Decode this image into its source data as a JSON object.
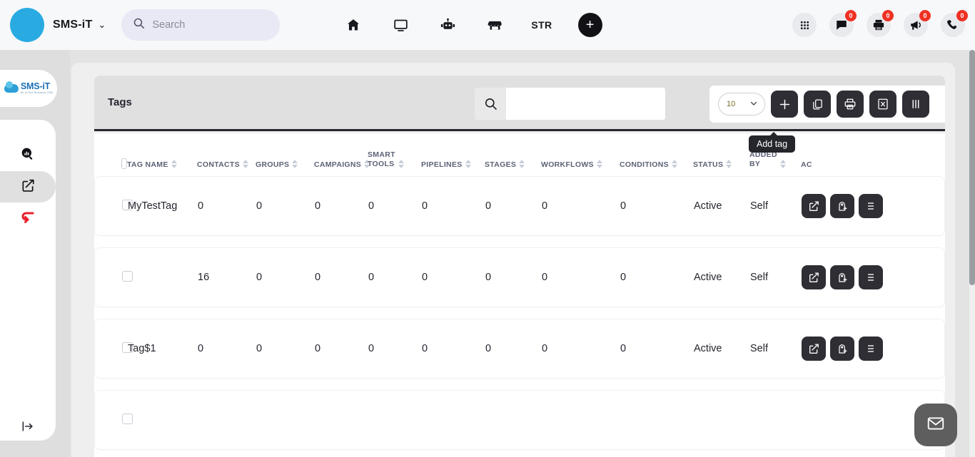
{
  "topbar": {
    "brand_name": "SMS-iT",
    "brand_caret": "⌄",
    "search_placeholder": "Search",
    "search_value": "",
    "nav_items": [
      {
        "name": "home-icon",
        "label": ""
      },
      {
        "name": "monitor-icon",
        "label": ""
      },
      {
        "name": "robot-icon",
        "label": ""
      },
      {
        "name": "store-icon",
        "label": ""
      },
      {
        "name": "str-label",
        "label": "STR"
      }
    ],
    "add_button_label": "+",
    "right_icons": [
      {
        "name": "apps-grid-icon",
        "badge": ""
      },
      {
        "name": "chat-icon",
        "badge": "0"
      },
      {
        "name": "printer-icon",
        "badge": "0"
      },
      {
        "name": "megaphone-icon",
        "badge": "0"
      },
      {
        "name": "phone-icon",
        "badge": "0"
      }
    ]
  },
  "sidebar": {
    "logo_main": "SMS-iT",
    "logo_sub": "All In One Business CRM",
    "items": [
      {
        "name": "analytics-search-icon",
        "label": "",
        "active": false
      },
      {
        "name": "edit-square-icon",
        "label": "",
        "active": true
      },
      {
        "name": "return-arrow-icon",
        "label": "",
        "active": false
      }
    ],
    "expand_label": ""
  },
  "toolbar": {
    "title": "Tags",
    "search_value": "",
    "search_placeholder": "",
    "page_size": "10",
    "buttons": [
      {
        "name": "add-tag-button",
        "icon": "plus-icon",
        "label": ""
      },
      {
        "name": "copy-button",
        "icon": "copy-icon",
        "label": ""
      },
      {
        "name": "print-button",
        "icon": "printer-icon",
        "label": ""
      },
      {
        "name": "excel-export-button",
        "icon": "excel-icon",
        "label": ""
      },
      {
        "name": "columns-button",
        "icon": "columns-icon",
        "label": ""
      }
    ],
    "tooltip": "Add tag"
  },
  "table": {
    "columns": [
      {
        "key": "checkbox",
        "label": ""
      },
      {
        "key": "tag_name",
        "label": "TAG NAME"
      },
      {
        "key": "contacts",
        "label": "CONTACTS"
      },
      {
        "key": "groups",
        "label": "GROUPS"
      },
      {
        "key": "campaigns",
        "label": "CAMPAIGNS"
      },
      {
        "key": "smart_tools",
        "label": "SMART TOOLS"
      },
      {
        "key": "pipelines",
        "label": "PIPELINES"
      },
      {
        "key": "stages",
        "label": "STAGES"
      },
      {
        "key": "workflows",
        "label": "WORKFLOWS"
      },
      {
        "key": "conditions",
        "label": "CONDITIONS"
      },
      {
        "key": "status",
        "label": "STATUS"
      },
      {
        "key": "added_by",
        "label": "ADDED BY"
      },
      {
        "key": "actions",
        "label": "AC"
      }
    ],
    "header_parts": {
      "smart_tools_1": "SMART",
      "smart_tools_2": "TOOLS",
      "added_by_1": "ADDED",
      "added_by_2": "BY"
    },
    "rows": [
      {
        "tag_name": "MyTestTag",
        "contacts": "0",
        "groups": "0",
        "campaigns": "0",
        "smart_tools": "0",
        "pipelines": "0",
        "stages": "0",
        "workflows": "0",
        "conditions": "0",
        "status": "Active",
        "added_by": "Self"
      },
      {
        "tag_name": "",
        "contacts": "16",
        "groups": "0",
        "campaigns": "0",
        "smart_tools": "0",
        "pipelines": "0",
        "stages": "0",
        "workflows": "0",
        "conditions": "0",
        "status": "Active",
        "added_by": "Self"
      },
      {
        "tag_name": "Tag$1",
        "contacts": "0",
        "groups": "0",
        "campaigns": "0",
        "smart_tools": "0",
        "pipelines": "0",
        "stages": "0",
        "workflows": "0",
        "conditions": "0",
        "status": "Active",
        "added_by": "Self"
      },
      {
        "tag_name": "",
        "contacts": "",
        "groups": "",
        "campaigns": "",
        "smart_tools": "",
        "pipelines": "",
        "stages": "",
        "workflows": "",
        "conditions": "",
        "status": "",
        "added_by": ""
      }
    ],
    "row_actions": [
      {
        "name": "edit-row-button",
        "icon": "edit-square-icon"
      },
      {
        "name": "add-tag-row-button",
        "icon": "tag-plus-icon"
      },
      {
        "name": "more-row-button",
        "icon": "more-icon"
      }
    ]
  },
  "fab": {
    "name": "mail-fab",
    "icon": "envelope-icon"
  },
  "colors": {
    "brand_blue": "#29abe2",
    "accent_dark": "#2e2e34",
    "badge_red": "#ef3124",
    "sidebar_red": "#e8212b"
  }
}
